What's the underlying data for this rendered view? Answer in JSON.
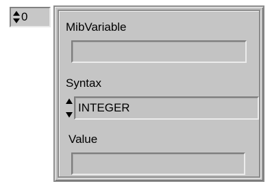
{
  "index_control": {
    "value": "0"
  },
  "cluster": {
    "mib_variable": {
      "label": "MibVariable",
      "value": ""
    },
    "syntax": {
      "label": "Syntax",
      "value": "INTEGER"
    },
    "value": {
      "label": "Value",
      "value": ""
    }
  },
  "colors": {
    "panel_gray": "#c5c5c5",
    "field_gray": "#c3c3c3",
    "shadow_dark": "#808080",
    "highlight": "#f0f0f0"
  },
  "icons": {
    "index_spinner": "up-down-arrows-icon",
    "syntax_spinner": "up-down-arrows-icon"
  }
}
